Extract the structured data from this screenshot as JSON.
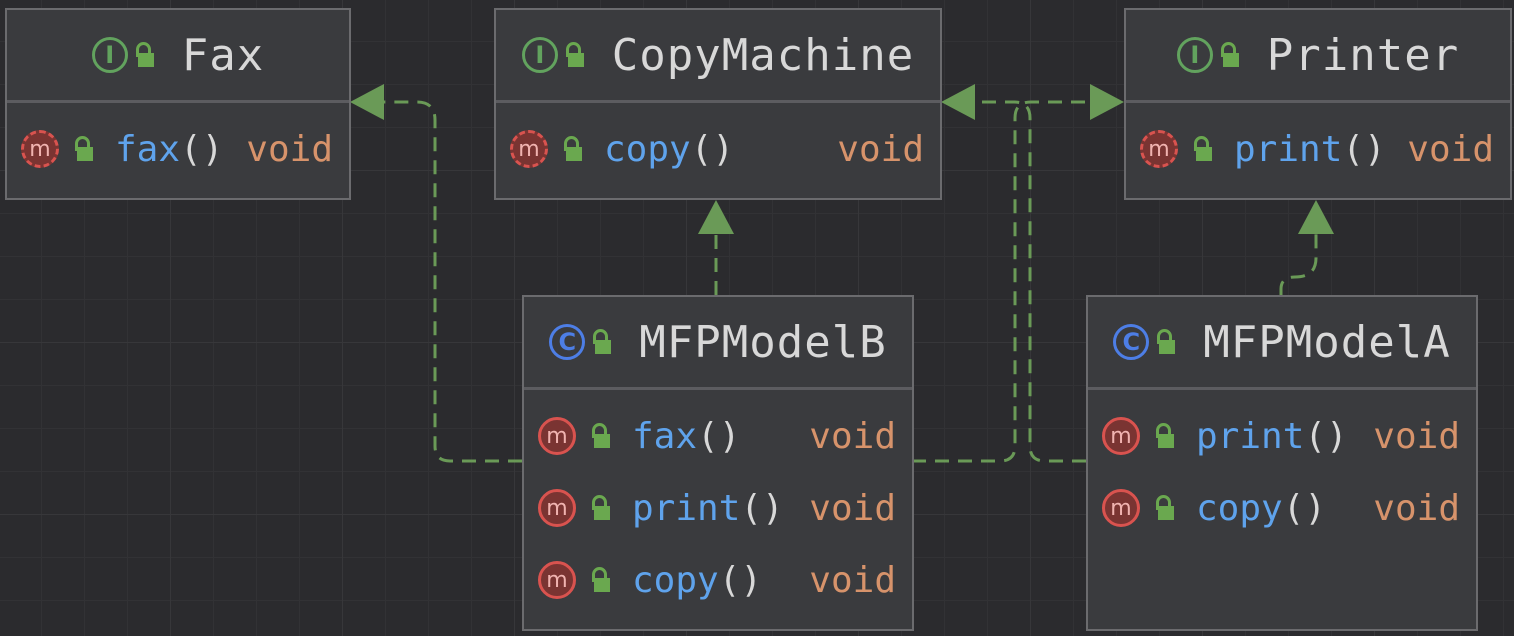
{
  "diagram": {
    "nodes": [
      {
        "id": "fax",
        "kind": "interface",
        "kind_letter": "I",
        "name": "Fax",
        "methods": [
          {
            "name": "fax",
            "parens": "()",
            "type": "void",
            "abstract": true
          }
        ]
      },
      {
        "id": "copymachine",
        "kind": "interface",
        "kind_letter": "I",
        "name": "CopyMachine",
        "methods": [
          {
            "name": "copy",
            "parens": "()",
            "type": "void",
            "abstract": true
          }
        ]
      },
      {
        "id": "printer",
        "kind": "interface",
        "kind_letter": "I",
        "name": "Printer",
        "methods": [
          {
            "name": "print",
            "parens": "()",
            "type": "void",
            "abstract": true
          }
        ]
      },
      {
        "id": "mfpmodelb",
        "kind": "class",
        "kind_letter": "C",
        "name": "MFPModelB",
        "methods": [
          {
            "name": "fax",
            "parens": "()",
            "type": "void",
            "abstract": false
          },
          {
            "name": "print",
            "parens": "()",
            "type": "void",
            "abstract": false
          },
          {
            "name": "copy",
            "parens": "()",
            "type": "void",
            "abstract": false
          }
        ]
      },
      {
        "id": "mfpmodela",
        "kind": "class",
        "kind_letter": "C",
        "name": "MFPModelA",
        "methods": [
          {
            "name": "print",
            "parens": "()",
            "type": "void",
            "abstract": false
          },
          {
            "name": "copy",
            "parens": "()",
            "type": "void",
            "abstract": false
          }
        ]
      }
    ],
    "edges": [
      {
        "from": "mfpmodelb",
        "to": "fax",
        "relation": "implements"
      },
      {
        "from": "mfpmodelb",
        "to": "copymachine",
        "relation": "implements"
      },
      {
        "from": "mfpmodelb",
        "to": "printer",
        "relation": "implements"
      },
      {
        "from": "mfpmodela",
        "to": "copymachine",
        "relation": "implements"
      },
      {
        "from": "mfpmodela",
        "to": "printer",
        "relation": "implements"
      }
    ],
    "colors": {
      "background": "#2b2b2e",
      "edge": "#6a9a57",
      "interface_icon": "#62a35e",
      "class_icon": "#4d7ee6",
      "method_icon": "#d9534f",
      "method_name": "#5fa3ec",
      "return_type": "#d7936b",
      "title": "#d8d8d8"
    }
  }
}
